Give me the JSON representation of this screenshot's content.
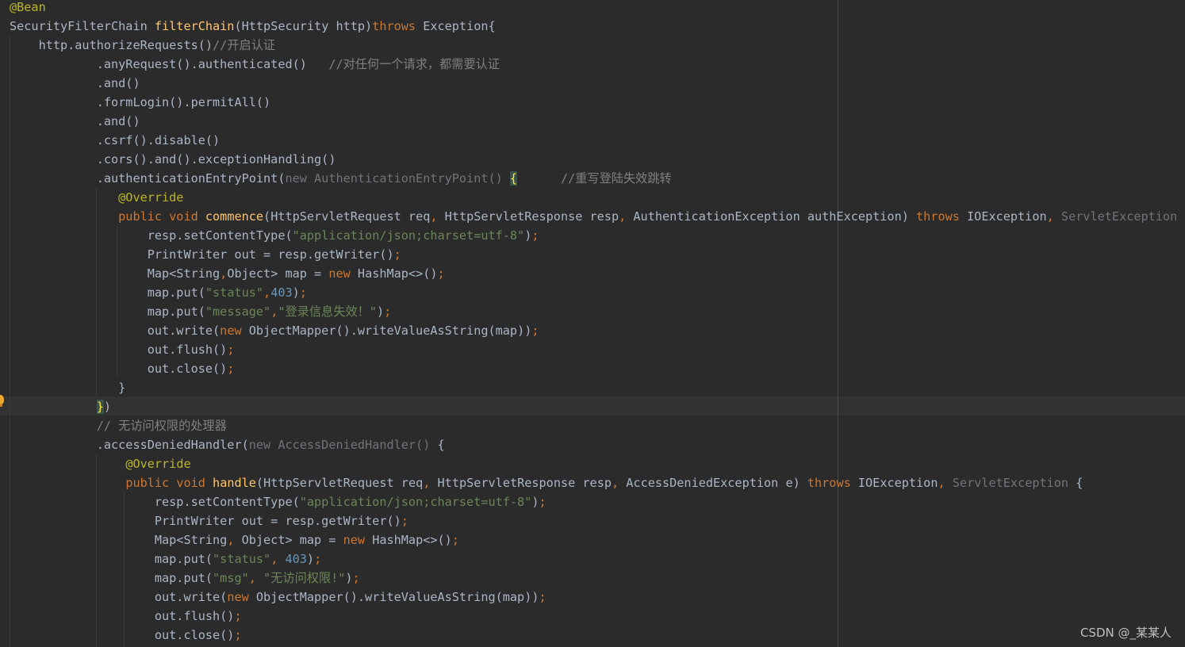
{
  "editor": {
    "language": "java",
    "theme": "darcula",
    "current_line_index": 21,
    "colors": {
      "background": "#2b2b2b",
      "default_text": "#a9b7c6",
      "keyword": "#cc7832",
      "annotation": "#bbb529",
      "method_declaration": "#ffc66d",
      "string": "#6a8759",
      "number": "#6897bb",
      "comment": "#808080",
      "unused": "#72737a",
      "matched_brace": "#ffef28",
      "caret_row": "#323232"
    },
    "lines": [
      {
        "tokens": [
          {
            "t": "@Bean",
            "c": "ann"
          }
        ]
      },
      {
        "tokens": [
          {
            "t": "SecurityFilterChain "
          },
          {
            "t": "filterChain",
            "c": "fn"
          },
          {
            "t": "(HttpSecurity http)"
          },
          {
            "t": "throws ",
            "c": "kw"
          },
          {
            "t": "Exception{"
          }
        ]
      },
      {
        "tokens": [
          {
            "t": "    http.authorizeRequests()"
          },
          {
            "t": "//开启认证",
            "c": "cmt"
          }
        ]
      },
      {
        "tokens": [
          {
            "t": "            .anyRequest().authenticated()   "
          },
          {
            "t": "//对任何一个请求，都需要认证",
            "c": "cmt"
          }
        ]
      },
      {
        "tokens": [
          {
            "t": "            .and()"
          }
        ]
      },
      {
        "tokens": [
          {
            "t": "            .formLogin().permitAll()"
          }
        ]
      },
      {
        "tokens": [
          {
            "t": "            .and()"
          }
        ]
      },
      {
        "tokens": [
          {
            "t": "            .csrf().disable()"
          }
        ]
      },
      {
        "tokens": [
          {
            "t": "            .cors().and().exceptionHandling()"
          }
        ]
      },
      {
        "tokens": [
          {
            "t": "            .authenticationEntryPoint("
          },
          {
            "t": "new AuthenticationEntryPoint() ",
            "c": "dim"
          },
          {
            "t": "{",
            "c": "brace"
          },
          {
            "t": "      "
          },
          {
            "t": "//重写登陆失效跳转",
            "c": "cmt"
          }
        ]
      },
      {
        "tokens": [
          {
            "t": "               "
          },
          {
            "t": "@Override",
            "c": "ann"
          }
        ]
      },
      {
        "tokens": [
          {
            "t": "               "
          },
          {
            "t": "public void ",
            "c": "kw"
          },
          {
            "t": "commence",
            "c": "fn"
          },
          {
            "t": "(HttpServletRequest req"
          },
          {
            "t": ", ",
            "c": "kw"
          },
          {
            "t": "HttpServletResponse resp"
          },
          {
            "t": ", ",
            "c": "kw"
          },
          {
            "t": "AuthenticationException authException) "
          },
          {
            "t": "throws ",
            "c": "kw"
          },
          {
            "t": "IOException"
          },
          {
            "t": ", ",
            "c": "kw"
          },
          {
            "t": "ServletException ",
            "c": "dim"
          },
          {
            "t": "{"
          }
        ]
      },
      {
        "tokens": [
          {
            "t": "                   resp.setContentType("
          },
          {
            "t": "\"application/json;charset=utf-8\"",
            "c": "str"
          },
          {
            "t": ")"
          },
          {
            "t": ";",
            "c": "kw"
          }
        ]
      },
      {
        "tokens": [
          {
            "t": "                   PrintWriter out = resp.getWriter()"
          },
          {
            "t": ";",
            "c": "kw"
          }
        ]
      },
      {
        "tokens": [
          {
            "t": "                   Map<String"
          },
          {
            "t": ",",
            "c": "kw"
          },
          {
            "t": "Object> map = "
          },
          {
            "t": "new ",
            "c": "kw"
          },
          {
            "t": "HashMap<>()"
          },
          {
            "t": ";",
            "c": "kw"
          }
        ]
      },
      {
        "tokens": [
          {
            "t": "                   map.put("
          },
          {
            "t": "\"status\"",
            "c": "str"
          },
          {
            "t": ",",
            "c": "kw"
          },
          {
            "t": "403",
            "c": "num"
          },
          {
            "t": ")"
          },
          {
            "t": ";",
            "c": "kw"
          }
        ]
      },
      {
        "tokens": [
          {
            "t": "                   map.put("
          },
          {
            "t": "\"message\"",
            "c": "str"
          },
          {
            "t": ",",
            "c": "kw"
          },
          {
            "t": "\"登录信息失效！\"",
            "c": "str"
          },
          {
            "t": ")"
          },
          {
            "t": ";",
            "c": "kw"
          }
        ]
      },
      {
        "tokens": [
          {
            "t": "                   out.write("
          },
          {
            "t": "new ",
            "c": "kw"
          },
          {
            "t": "ObjectMapper().writeValueAsString(map))"
          },
          {
            "t": ";",
            "c": "kw"
          }
        ]
      },
      {
        "tokens": [
          {
            "t": "                   out.flush()"
          },
          {
            "t": ";",
            "c": "kw"
          }
        ]
      },
      {
        "tokens": [
          {
            "t": "                   out.close()"
          },
          {
            "t": ";",
            "c": "kw"
          }
        ]
      },
      {
        "tokens": [
          {
            "t": "               }"
          }
        ]
      },
      {
        "tokens": [
          {
            "t": "            "
          },
          {
            "t": "}",
            "c": "brace"
          },
          {
            "t": ")"
          }
        ]
      },
      {
        "tokens": [
          {
            "t": "            "
          },
          {
            "t": "// 无访问权限的处理器",
            "c": "cmt"
          }
        ]
      },
      {
        "tokens": [
          {
            "t": "            .accessDeniedHandler("
          },
          {
            "t": "new AccessDeniedHandler() ",
            "c": "dim"
          },
          {
            "t": "{"
          }
        ]
      },
      {
        "tokens": [
          {
            "t": "                "
          },
          {
            "t": "@Override",
            "c": "ann"
          }
        ]
      },
      {
        "tokens": [
          {
            "t": "                "
          },
          {
            "t": "public void ",
            "c": "kw"
          },
          {
            "t": "handle",
            "c": "fn"
          },
          {
            "t": "(HttpServletRequest req"
          },
          {
            "t": ", ",
            "c": "kw"
          },
          {
            "t": "HttpServletResponse resp"
          },
          {
            "t": ", ",
            "c": "kw"
          },
          {
            "t": "AccessDeniedException e) "
          },
          {
            "t": "throws ",
            "c": "kw"
          },
          {
            "t": "IOException"
          },
          {
            "t": ", ",
            "c": "kw"
          },
          {
            "t": "ServletException ",
            "c": "dim"
          },
          {
            "t": "{"
          }
        ]
      },
      {
        "tokens": [
          {
            "t": "                    resp.setContentType("
          },
          {
            "t": "\"application/json;charset=utf-8\"",
            "c": "str"
          },
          {
            "t": ")"
          },
          {
            "t": ";",
            "c": "kw"
          }
        ]
      },
      {
        "tokens": [
          {
            "t": "                    PrintWriter out = resp.getWriter()"
          },
          {
            "t": ";",
            "c": "kw"
          }
        ]
      },
      {
        "tokens": [
          {
            "t": "                    Map<String"
          },
          {
            "t": ", ",
            "c": "kw"
          },
          {
            "t": "Object> map = "
          },
          {
            "t": "new ",
            "c": "kw"
          },
          {
            "t": "HashMap<>()"
          },
          {
            "t": ";",
            "c": "kw"
          }
        ]
      },
      {
        "tokens": [
          {
            "t": "                    map.put("
          },
          {
            "t": "\"status\"",
            "c": "str"
          },
          {
            "t": ", ",
            "c": "kw"
          },
          {
            "t": "403",
            "c": "num"
          },
          {
            "t": ")"
          },
          {
            "t": ";",
            "c": "kw"
          }
        ]
      },
      {
        "tokens": [
          {
            "t": "                    map.put("
          },
          {
            "t": "\"msg\"",
            "c": "str"
          },
          {
            "t": ", ",
            "c": "kw"
          },
          {
            "t": "\"无访问权限!\"",
            "c": "str"
          },
          {
            "t": ")"
          },
          {
            "t": ";",
            "c": "kw"
          }
        ]
      },
      {
        "tokens": [
          {
            "t": "                    out.write("
          },
          {
            "t": "new ",
            "c": "kw"
          },
          {
            "t": "ObjectMapper().writeValueAsString(map))"
          },
          {
            "t": ";",
            "c": "kw"
          }
        ]
      },
      {
        "tokens": [
          {
            "t": "                    out.flush()"
          },
          {
            "t": ";",
            "c": "kw"
          }
        ]
      },
      {
        "tokens": [
          {
            "t": "                    out.close()"
          },
          {
            "t": ";",
            "c": "kw"
          }
        ]
      }
    ]
  },
  "gutter": {
    "intention_icon": "lightbulb-icon"
  },
  "watermark": {
    "text": "CSDN @_某某人"
  }
}
